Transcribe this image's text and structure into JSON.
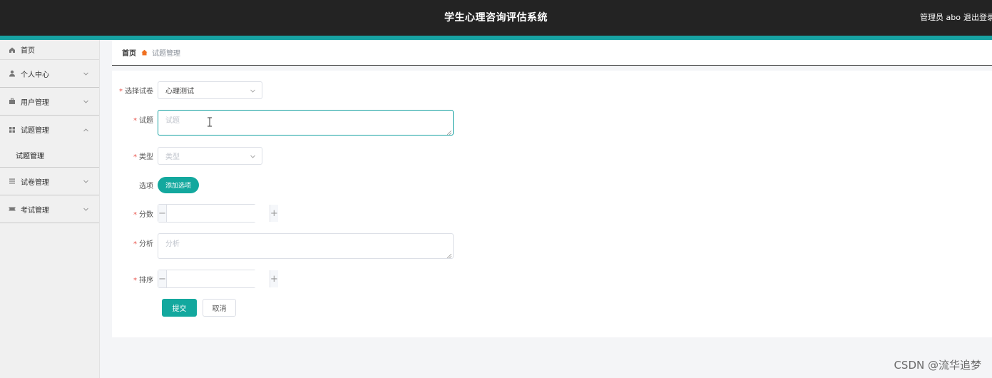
{
  "header": {
    "title": "学生心理咨询评估系统",
    "user": "管理员 abo",
    "logout": "退出登录",
    "bg_color": "#232323",
    "accent_color": "#17a2a2"
  },
  "sidebar": {
    "items": [
      {
        "label": "首页",
        "icon": "home-icon"
      },
      {
        "label": "个人中心",
        "icon": "user-icon"
      },
      {
        "label": "用户管理",
        "icon": "briefcase-icon"
      },
      {
        "label": "试题管理",
        "icon": "grid-icon",
        "expanded": true,
        "sub": [
          "试题管理"
        ]
      },
      {
        "label": "试卷管理",
        "icon": "list-icon"
      },
      {
        "label": "考试管理",
        "icon": "ticket-icon"
      }
    ]
  },
  "breadcrumb": {
    "home": "首页",
    "current": "试题管理"
  },
  "form": {
    "paper": {
      "label": "选择试卷",
      "value": "心理测试"
    },
    "question": {
      "label": "试题",
      "placeholder": "试题"
    },
    "type": {
      "label": "类型",
      "placeholder": "类型"
    },
    "options": {
      "label": "选项",
      "add_label": "添加选项"
    },
    "score": {
      "label": "分数",
      "value": ""
    },
    "analysis": {
      "label": "分析",
      "placeholder": "分析"
    },
    "order": {
      "label": "排序",
      "value": ""
    },
    "submit_label": "提交",
    "cancel_label": "取消",
    "primary_color": "#13a89e"
  },
  "watermark": "CSDN @流华追梦"
}
